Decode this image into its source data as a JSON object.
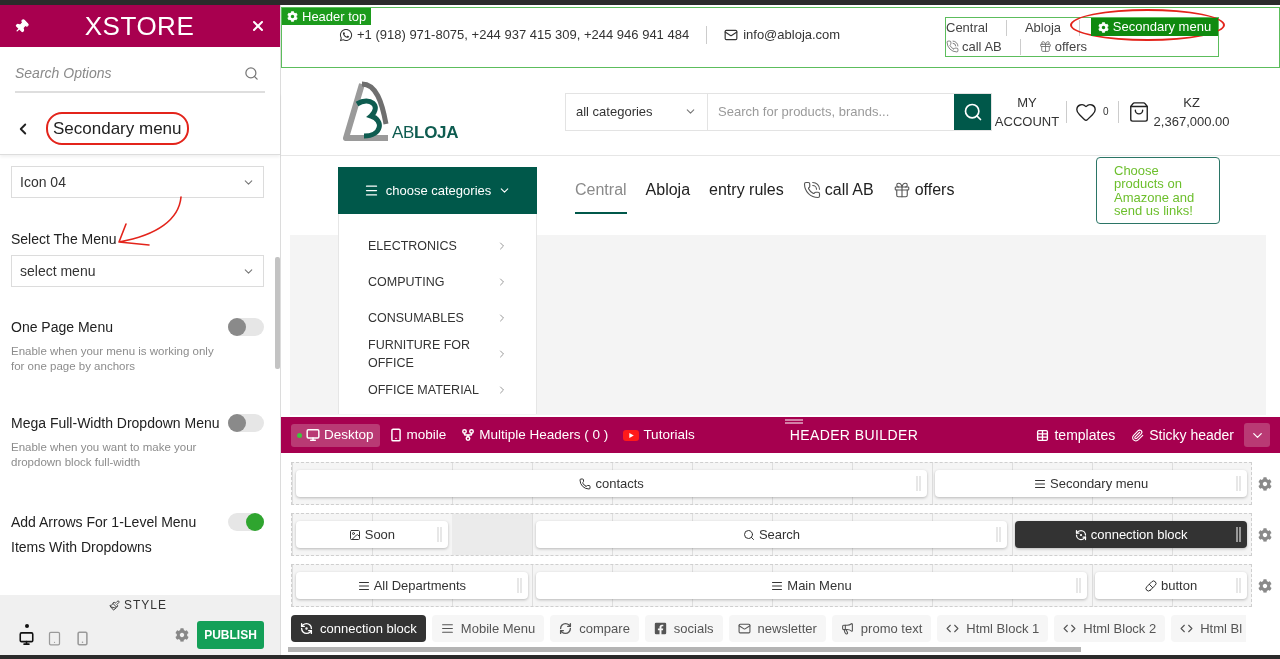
{
  "customizer": {
    "brand": "XSTORE",
    "search": {
      "placeholder": "Search Options"
    },
    "section_title": "Secondary menu",
    "fields": [
      {
        "kind": "select",
        "value": "Icon 04"
      },
      {
        "kind": "select",
        "label": "Select The Menu",
        "value": "select menu"
      },
      {
        "kind": "toggle",
        "label": "One Page Menu",
        "description": "Enable when your menu is working only for one page by anchors",
        "on": false
      },
      {
        "kind": "toggle",
        "label": "Mega Full-Width Dropdown Menu",
        "description": "Enable when you want to make your dropdown block full-width",
        "on": false
      },
      {
        "kind": "toggle",
        "label": "Add Arrows For 1-Level Menu Items With Dropdowns",
        "on": true
      }
    ],
    "style_label": "STYLE",
    "devices": [
      {
        "kind": "desktop",
        "selected": true
      },
      {
        "kind": "tablet",
        "selected": false
      },
      {
        "kind": "mobile",
        "selected": false
      }
    ],
    "publish_button": "PUBLISH"
  },
  "preview": {
    "header_top": {
      "tag": "Header top",
      "phones": "+1 (918) 971-8075, +244 937 415 309, +244 946 941 484",
      "email": "info@abloja.com",
      "secondary_menu": {
        "items": [
          {
            "label": "Central"
          },
          {
            "label": "Abloja"
          },
          {
            "label": "call AB",
            "kind": "call"
          },
          {
            "label": "offers",
            "kind": "gift"
          }
        ],
        "tag": "Secondary menu"
      }
    },
    "main_header": {
      "logo": "AB**LOJA**",
      "category_select": "all categories",
      "search": {
        "placeholder": "Search for products, brands..."
      },
      "account": "MY ACCOUNT",
      "wishlist_count": "0",
      "cart_currency": "KZ",
      "cart_total": "2,367,000.00"
    },
    "nav": {
      "categories_button": "choose categories",
      "links": [
        {
          "label": "Central",
          "selected": true
        },
        {
          "label": "Abloja",
          "selected": false
        },
        {
          "label": "entry rules",
          "selected": false
        },
        {
          "label": "call AB",
          "kind": "call",
          "selected": false
        },
        {
          "label": "offers",
          "kind": "gift",
          "selected": false
        }
      ],
      "promo": "Choose products on Amazone and send us links!"
    },
    "categories": [
      {
        "label": "ELECTRONICS"
      },
      {
        "label": "COMPUTING"
      },
      {
        "label": "CONSUMABLES"
      },
      {
        "label": "FURNITURE FOR OFFICE"
      },
      {
        "label": "OFFICE MATERIAL"
      }
    ]
  },
  "builder": {
    "tabs": [
      {
        "label": "Desktop",
        "kind": "desktop",
        "selected": true
      },
      {
        "label": "mobile",
        "kind": "mobile",
        "selected": false
      },
      {
        "label": "Multiple Headers ( 0 )",
        "kind": "headers",
        "selected": false
      },
      {
        "label": "Tutorials",
        "kind": "video",
        "selected": false
      }
    ],
    "title": "HEADER BUILDER",
    "actions": [
      {
        "label": "templates",
        "kind": "templates"
      },
      {
        "label": "Sticky header",
        "kind": "sticky"
      }
    ],
    "rows": [
      {
        "blocks": [
          {
            "label": "contacts",
            "kind": "phone"
          },
          {
            "label": "Secondary menu",
            "kind": "menu"
          }
        ]
      },
      {
        "blocks": [
          {
            "label": "Soon",
            "kind": "image"
          },
          {
            "kind": "empty"
          },
          {
            "label": "Search",
            "kind": "search"
          },
          {
            "label": "connection block",
            "kind": "connection"
          }
        ]
      },
      {
        "blocks": [
          {
            "label": "All Departments",
            "kind": "menu"
          },
          {
            "label": "Main Menu",
            "kind": "menu"
          },
          {
            "label": "button",
            "kind": "button"
          }
        ]
      }
    ],
    "elements": [
      {
        "label": "connection block",
        "kind": "connection"
      },
      {
        "label": "Mobile Menu",
        "kind": "menu"
      },
      {
        "label": "compare",
        "kind": "refresh"
      },
      {
        "label": "socials",
        "kind": "facebook"
      },
      {
        "label": "newsletter",
        "kind": "mail"
      },
      {
        "label": "promo text",
        "kind": "megaphone"
      },
      {
        "label": "Html Block 1",
        "kind": "code"
      },
      {
        "label": "Html Block 2",
        "kind": "code"
      },
      {
        "label": "Html Bl",
        "kind": "code"
      }
    ]
  }
}
